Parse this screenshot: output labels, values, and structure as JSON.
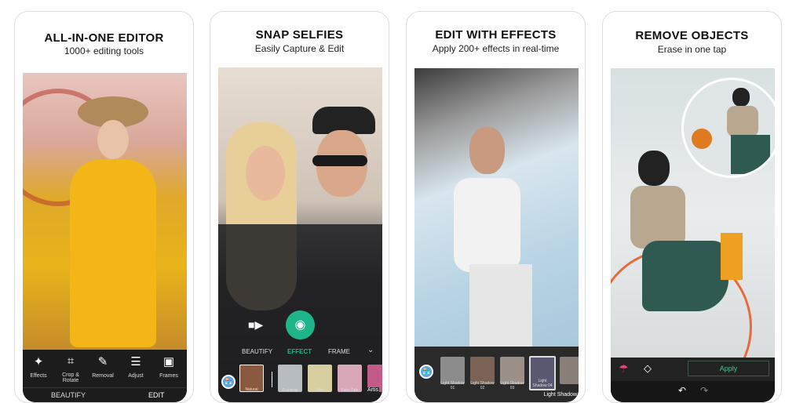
{
  "cards": [
    {
      "title": "ALL-IN-ONE EDITOR",
      "subtitle": "1000+ editing tools",
      "tools": [
        {
          "label": "Effects",
          "icon": "magic-wand-icon"
        },
        {
          "label": "Crop & Rotate",
          "icon": "crop-icon"
        },
        {
          "label": "Removal",
          "icon": "eraser-brush-icon"
        },
        {
          "label": "Adjust",
          "icon": "sliders-icon"
        },
        {
          "label": "Frames",
          "icon": "frame-icon"
        }
      ],
      "tabs": [
        "BEAUTIFY",
        "EDIT"
      ],
      "active_tab": "EDIT"
    },
    {
      "title": "SNAP SELFIES",
      "subtitle": "Easily Capture & Edit",
      "tabs": [
        "BEAUTIFY",
        "EFFECT",
        "FRAME"
      ],
      "active_tab": "EFFECT",
      "filters": [
        "Natural",
        "Raindrop",
        "Film",
        "Fairy Tale",
        "Artis"
      ]
    },
    {
      "title": "EDIT WITH EFFECTS",
      "subtitle": "Apply 200+ effects in real-time",
      "filters": [
        "Light Shadow 01",
        "Light Shadow 02",
        "Light Shadow 03",
        "Light Shadow 04",
        "Light Shadow"
      ],
      "selected_filter": "Light Shadow 04"
    },
    {
      "title": "REMOVE OBJECTS",
      "subtitle": "Erase in one tap",
      "apply_label": "Apply"
    }
  ],
  "colors": {
    "accent_green": "#1fb58a",
    "edit_pink": "#e0457b",
    "bar": "#1c1c1c"
  }
}
